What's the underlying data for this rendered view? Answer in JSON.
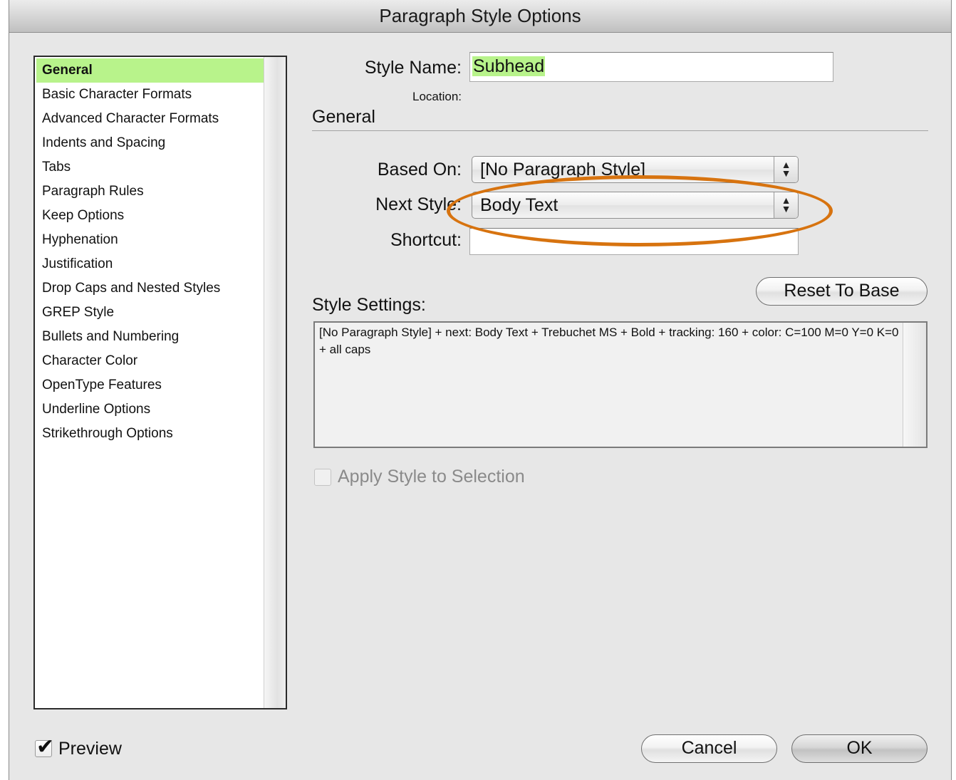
{
  "window": {
    "title": "Paragraph Style Options"
  },
  "categories": [
    "General",
    "Basic Character Formats",
    "Advanced Character Formats",
    "Indents and Spacing",
    "Tabs",
    "Paragraph Rules",
    "Keep Options",
    "Hyphenation",
    "Justification",
    "Drop Caps and Nested Styles",
    "GREP Style",
    "Bullets and Numbering",
    "Character Color",
    "OpenType Features",
    "Underline Options",
    "Strikethrough Options"
  ],
  "selected_category": "General",
  "style_name": {
    "label": "Style Name:",
    "value": "Subhead"
  },
  "location": {
    "label": "Location:"
  },
  "section": {
    "title": "General"
  },
  "based_on": {
    "label": "Based On:",
    "value": "[No Paragraph Style]"
  },
  "next_style": {
    "label": "Next Style:",
    "value": "Body Text"
  },
  "shortcut": {
    "label": "Shortcut:",
    "value": ""
  },
  "reset_button": {
    "label": "Reset To Base"
  },
  "style_settings": {
    "label": "Style Settings:",
    "text": "[No Paragraph Style] + next: Body Text + Trebuchet MS + Bold + tracking: 160 + color: C=100 M=0 Y=0 K=0 + all caps"
  },
  "apply_style": {
    "label": "Apply Style to Selection",
    "checked": false,
    "enabled": false
  },
  "preview": {
    "label": "Preview",
    "checked": true
  },
  "buttons": {
    "cancel": "Cancel",
    "ok": "OK"
  },
  "colors": {
    "selection": "#b8f38b",
    "annotation": "#d7730f"
  }
}
